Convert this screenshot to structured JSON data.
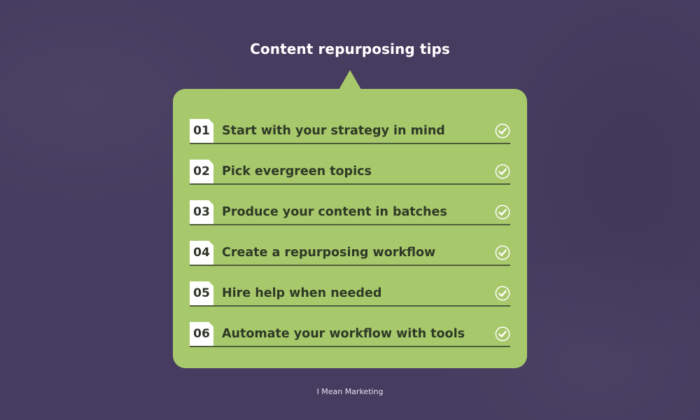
{
  "title": "Content repurposing tips",
  "tips": [
    {
      "number": "01",
      "text": "Start with your strategy in mind",
      "icon": "check-circle-icon"
    },
    {
      "number": "02",
      "text": "Pick evergreen topics",
      "icon": "check-circle-icon"
    },
    {
      "number": "03",
      "text": "Produce your content in batches",
      "icon": "check-circle-icon"
    },
    {
      "number": "04",
      "text": "Create a repurposing workflow",
      "icon": "check-circle-icon"
    },
    {
      "number": "05",
      "text": "Hire help when needed",
      "icon": "check-circle-icon"
    },
    {
      "number": "06",
      "text": "Automate your workflow with tools",
      "icon": "check-circle-icon"
    }
  ],
  "footer": "I Mean Marketing",
  "colors": {
    "background": "#463c5f",
    "card": "#a8c86c",
    "text_dark": "#2e3a26",
    "accent_white": "#ffffff"
  }
}
